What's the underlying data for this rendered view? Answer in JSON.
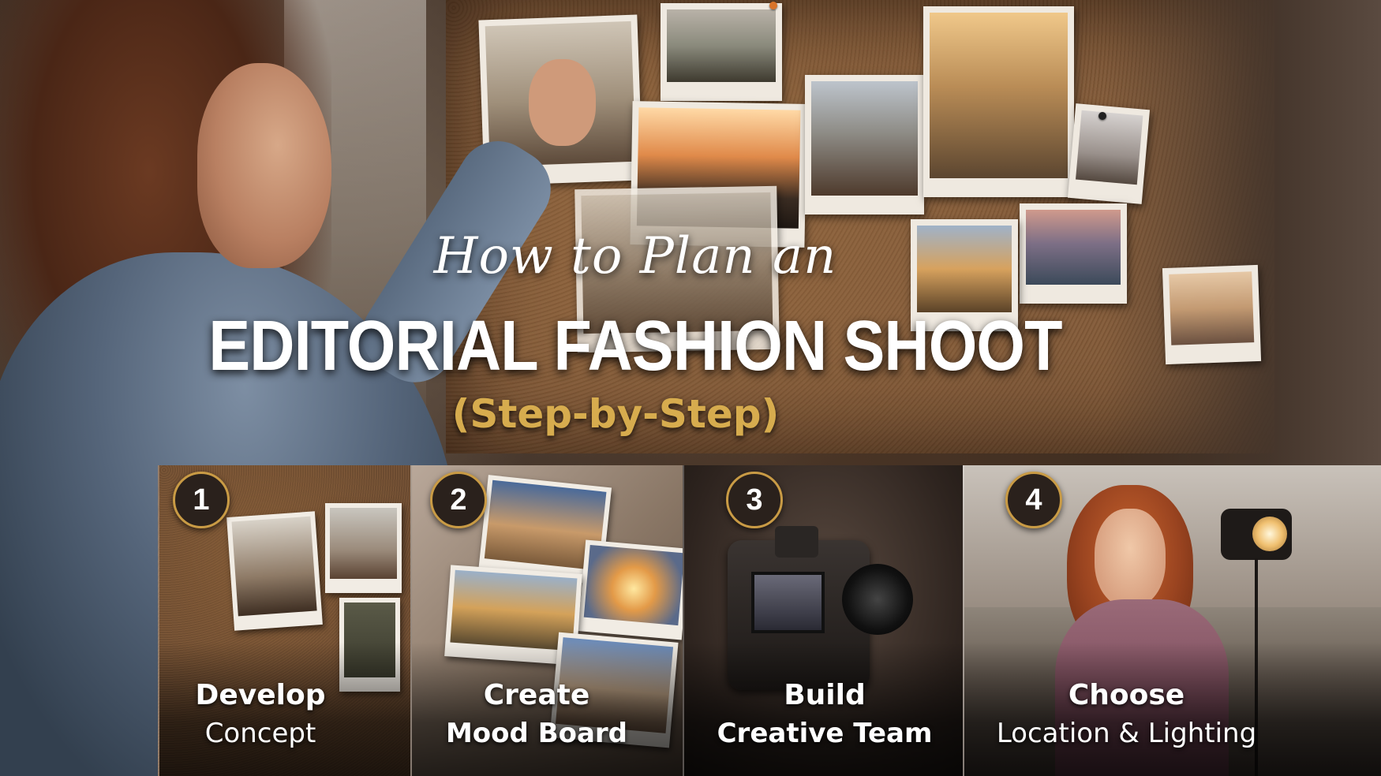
{
  "hero": {
    "title_script": "How to Plan an",
    "title_main": "EDITORIAL FASHION SHOOT",
    "title_sub": "(Step-by-Step)"
  },
  "steps": [
    {
      "number": "1",
      "line1": "Develop",
      "line2": "Concept"
    },
    {
      "number": "2",
      "line1": "Create",
      "line2": "Mood Board"
    },
    {
      "number": "3",
      "line1": "Build",
      "line2": "Creative Team"
    },
    {
      "number": "4",
      "line1": "Choose",
      "line2": "Location & Lighting"
    }
  ],
  "colors": {
    "accent_gold": "#d7ac4e",
    "badge_border": "#c99b45",
    "badge_fill": "#2a211c",
    "text_white": "#ffffff"
  }
}
